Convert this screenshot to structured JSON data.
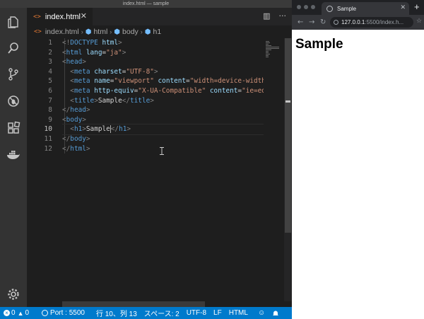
{
  "window": {
    "title": "index.html — sample"
  },
  "activity_bar": {
    "items": [
      "files-icon",
      "search-icon",
      "source-control-icon",
      "debug-icon",
      "extensions-icon",
      "docker-icon"
    ],
    "settings": "gear-icon"
  },
  "tab": {
    "label": "index.html",
    "close": "✕"
  },
  "tab_actions": {
    "split": "▥",
    "more": "···"
  },
  "breadcrumb": [
    "index.html",
    "html",
    "body",
    "h1"
  ],
  "editor": {
    "line_numbers": [
      "1",
      "2",
      "3",
      "4",
      "5",
      "6",
      "7",
      "8",
      "9",
      "10",
      "11",
      "12"
    ],
    "active_line": 10,
    "lines": [
      [
        [
          "br",
          "<!"
        ],
        [
          "tag",
          "DOCTYPE"
        ],
        [
          "txt",
          " "
        ],
        [
          "attr",
          "html"
        ],
        [
          "br",
          ">"
        ]
      ],
      [
        [
          "br",
          "<"
        ],
        [
          "tag",
          "html"
        ],
        [
          "txt",
          " "
        ],
        [
          "attr",
          "lang"
        ],
        [
          "txt",
          "="
        ],
        [
          "str",
          "\"ja\""
        ],
        [
          "br",
          ">"
        ]
      ],
      [
        [
          "br",
          "<"
        ],
        [
          "tag",
          "head"
        ],
        [
          "br",
          ">"
        ]
      ],
      [
        [
          "txt",
          "  "
        ],
        [
          "br",
          "<"
        ],
        [
          "tag",
          "meta"
        ],
        [
          "txt",
          " "
        ],
        [
          "attr",
          "charset"
        ],
        [
          "txt",
          "="
        ],
        [
          "str",
          "\"UTF-8\""
        ],
        [
          "br",
          ">"
        ]
      ],
      [
        [
          "txt",
          "  "
        ],
        [
          "br",
          "<"
        ],
        [
          "tag",
          "meta"
        ],
        [
          "txt",
          " "
        ],
        [
          "attr",
          "name"
        ],
        [
          "txt",
          "="
        ],
        [
          "str",
          "\"viewport\""
        ],
        [
          "txt",
          " "
        ],
        [
          "attr",
          "content"
        ],
        [
          "txt",
          "="
        ],
        [
          "str",
          "\"width=device-width, "
        ]
      ],
      [
        [
          "txt",
          "  "
        ],
        [
          "br",
          "<"
        ],
        [
          "tag",
          "meta"
        ],
        [
          "txt",
          " "
        ],
        [
          "attr",
          "http-equiv"
        ],
        [
          "txt",
          "="
        ],
        [
          "str",
          "\"X-UA-Compatible\""
        ],
        [
          "txt",
          " "
        ],
        [
          "attr",
          "content"
        ],
        [
          "txt",
          "="
        ],
        [
          "str",
          "\"ie=edge"
        ]
      ],
      [
        [
          "txt",
          "  "
        ],
        [
          "br",
          "<"
        ],
        [
          "tag",
          "title"
        ],
        [
          "br",
          ">"
        ],
        [
          "txt",
          "Sample"
        ],
        [
          "br",
          "</"
        ],
        [
          "tag",
          "title"
        ],
        [
          "br",
          ">"
        ]
      ],
      [
        [
          "br",
          "</"
        ],
        [
          "tag",
          "head"
        ],
        [
          "br",
          ">"
        ]
      ],
      [
        [
          "br",
          "<"
        ],
        [
          "tag",
          "body"
        ],
        [
          "br",
          ">"
        ]
      ],
      [
        [
          "txt",
          "  "
        ],
        [
          "br",
          "<"
        ],
        [
          "tag",
          "h1"
        ],
        [
          "br",
          ">"
        ],
        [
          "txt",
          "Sample"
        ],
        [
          "caret",
          ""
        ],
        [
          "br",
          "</"
        ],
        [
          "tag",
          "h1"
        ],
        [
          "br",
          ">"
        ]
      ],
      [
        [
          "br",
          "</"
        ],
        [
          "tag",
          "body"
        ],
        [
          "br",
          ">"
        ]
      ],
      [
        [
          "br",
          "</"
        ],
        [
          "tag",
          "html"
        ],
        [
          "br",
          ">"
        ]
      ]
    ]
  },
  "status_bar": {
    "errors": "0",
    "warnings": "0",
    "port": "Port : 5500",
    "position": "行 10、列 13",
    "spaces": "スペース: 2",
    "encoding": "UTF-8",
    "eol": "LF",
    "language": "HTML"
  },
  "browser": {
    "tab_title": "Sample",
    "tab_close": "✕",
    "new_tab": "+",
    "url_host": "127.0.0.1",
    "url_rest": ":5500/index.h...",
    "page_heading": "Sample"
  },
  "colors": {
    "accent": "#007acc",
    "tag": "#569cd6",
    "attr": "#9cdcfe",
    "string": "#ce9178"
  }
}
